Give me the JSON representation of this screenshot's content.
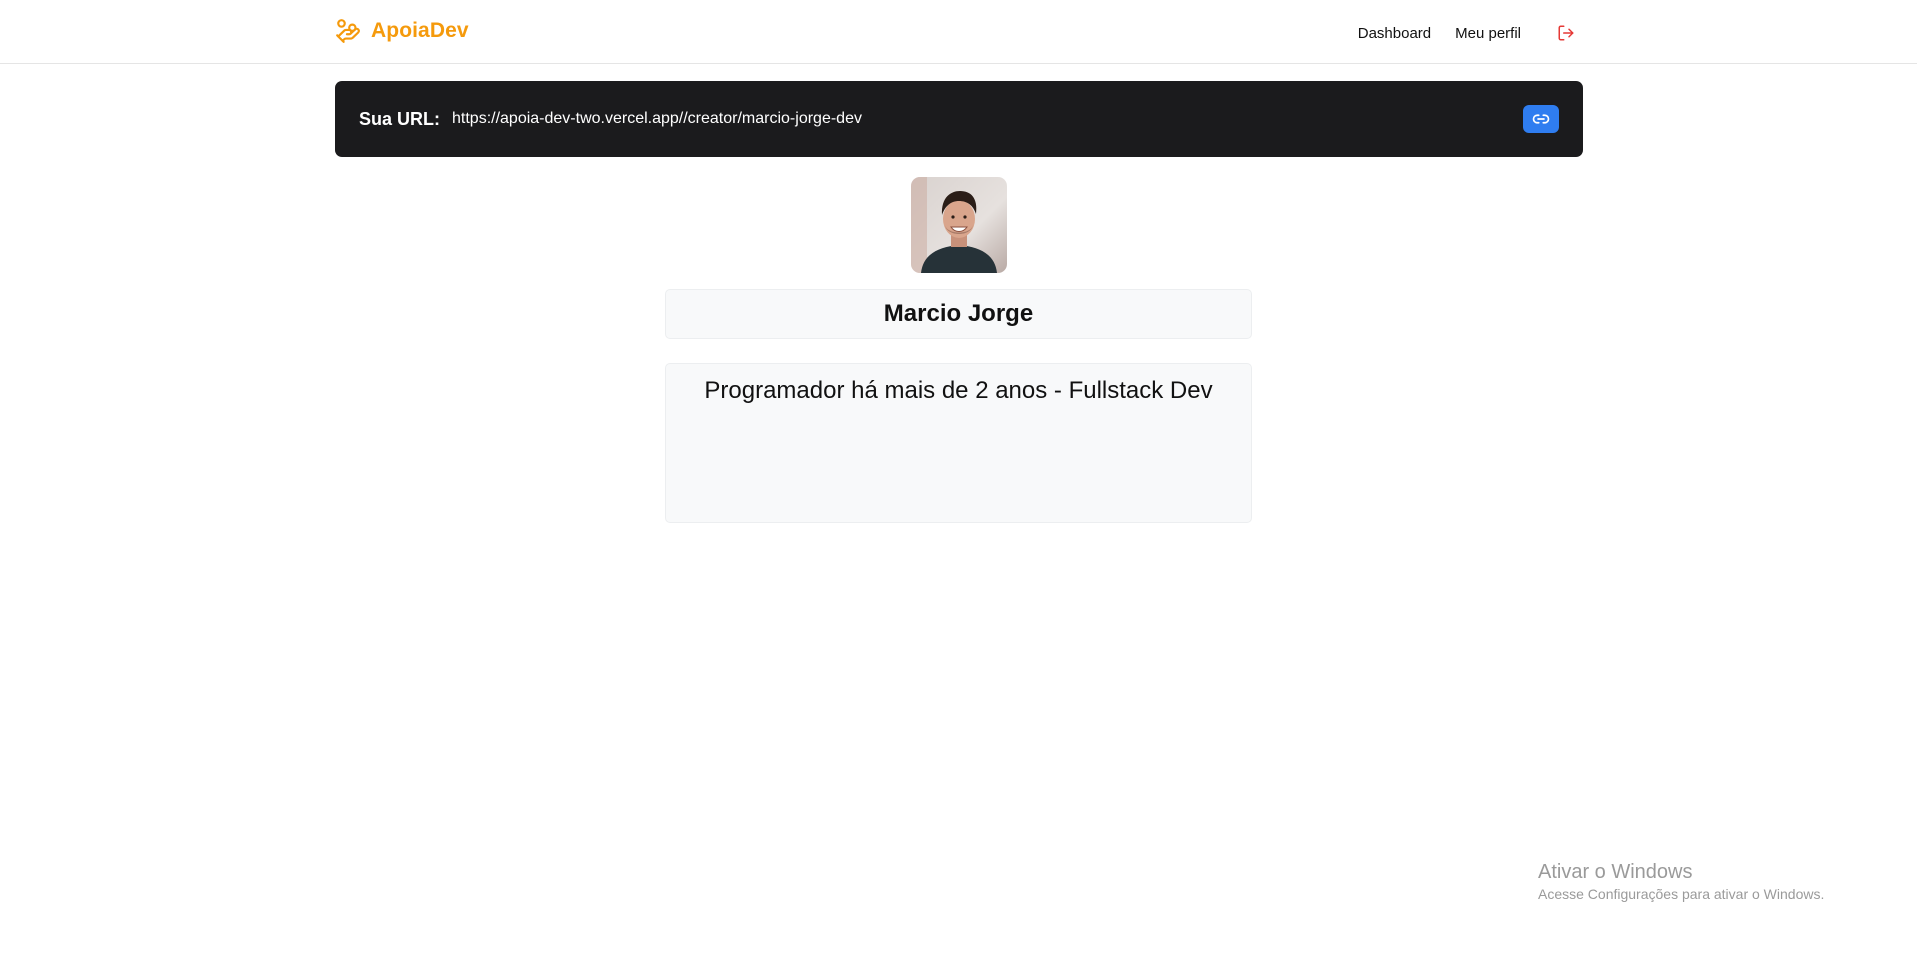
{
  "header": {
    "brand_name": "ApoiaDev",
    "brand_icon": "hand-coins-icon",
    "nav": [
      {
        "label": "Dashboard"
      },
      {
        "label": "Meu perfil"
      }
    ],
    "logout_icon": "logout-icon"
  },
  "url_bar": {
    "label": "Sua URL:",
    "value": "https://apoia-dev-two.vercel.app//creator/marcio-jorge-dev",
    "copy_icon": "link-icon"
  },
  "profile": {
    "name": "Marcio Jorge",
    "bio": "Programador há mais de 2 anos - Fullstack Dev"
  },
  "watermark": {
    "title": "Ativar o Windows",
    "subtitle": "Acesse Configurações para ativar o Windows."
  },
  "colors": {
    "brand": "#f59a0c",
    "url_bar_bg": "#1b1b1d",
    "copy_button": "#2f7df0",
    "logout": "#e53935",
    "field_bg": "#f8f9fa"
  }
}
